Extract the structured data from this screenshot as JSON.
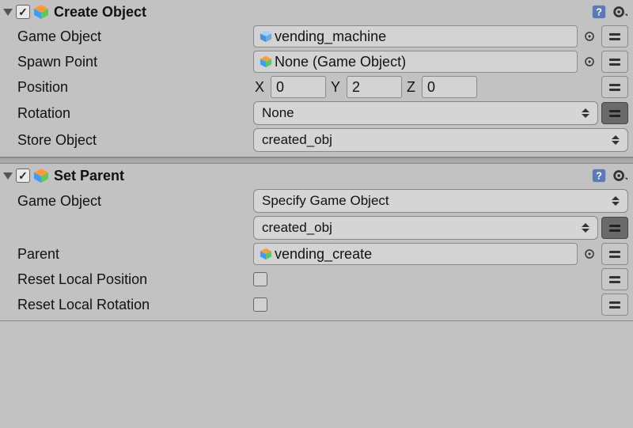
{
  "create_object": {
    "title": "Create Object",
    "enabled_check": "✓",
    "rows": {
      "game_object_label": "Game Object",
      "game_object_value": "vending_machine",
      "spawn_point_label": "Spawn Point",
      "spawn_point_value": "None (Game Object)",
      "position_label": "Position",
      "position_x_label": "X",
      "position_x": "0",
      "position_y_label": "Y",
      "position_y": "2",
      "position_z_label": "Z",
      "position_z": "0",
      "rotation_label": "Rotation",
      "rotation_value": "None",
      "store_object_label": "Store Object",
      "store_object_value": "created_obj"
    }
  },
  "set_parent": {
    "title": "Set Parent",
    "enabled_check": "✓",
    "rows": {
      "game_object_label": "Game Object",
      "game_object_mode": "Specify Game Object",
      "game_object_var": "created_obj",
      "parent_label": "Parent",
      "parent_value": "vending_create",
      "reset_pos_label": "Reset Local Position",
      "reset_rot_label": "Reset Local Rotation"
    }
  }
}
